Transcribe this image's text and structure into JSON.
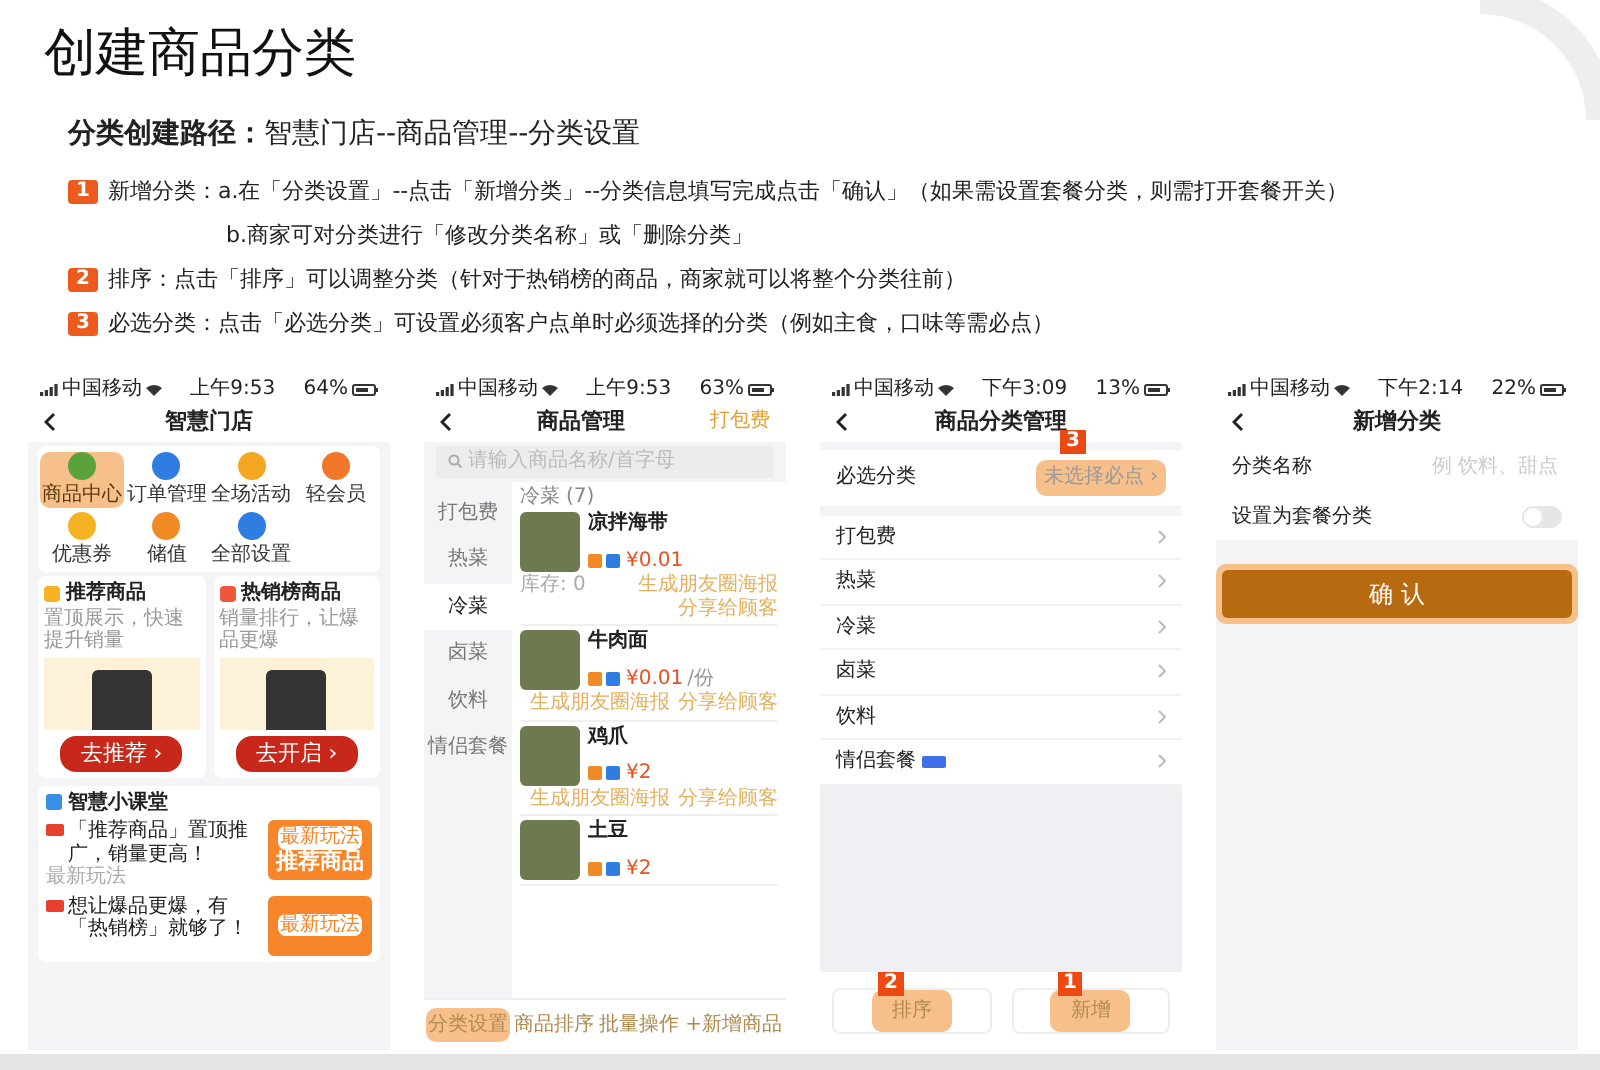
{
  "title": "创建商品分类",
  "path": {
    "label": "分类创建路径：",
    "value": "智慧门店--商品管理--分类设置"
  },
  "steps": [
    {
      "number": "1",
      "lines": [
        "新增分类：a.在「分类设置」--点击「新增分类」--分类信息填写完成点击「确认」（如果需设置套餐分类，则需打开套餐开关）",
        "b.商家可对分类进行「修改分类名称」或「删除分类」"
      ]
    },
    {
      "number": "2",
      "lines": [
        "排序：点击「排序」可以调整分类（针对于热销榜的商品，商家就可以将整个分类往前）"
      ]
    },
    {
      "number": "3",
      "lines": [
        "必选分类：点击「必选分类」可设置必须客户点单时必须选择的分类（例如主食，口味等需必点）"
      ]
    }
  ],
  "screens": [
    {
      "kind": "store",
      "status": {
        "carrier": "中国移动",
        "time": "上午9:53",
        "battery": "64%"
      },
      "title": "智慧门店",
      "grid": [
        {
          "label": "商品中心",
          "color": "#5aa23c",
          "highlighted": true
        },
        {
          "label": "订单管理",
          "color": "#2f7de1",
          "highlighted": false
        },
        {
          "label": "全场活动",
          "color": "#f5a623",
          "highlighted": false
        },
        {
          "label": "轻会员",
          "color": "#f07828",
          "highlighted": false
        },
        {
          "label": "优惠券",
          "color": "#f5b323",
          "highlighted": false
        },
        {
          "label": "储值",
          "color": "#f08a24",
          "highlighted": false
        },
        {
          "label": "全部设置",
          "color": "#2f7de1",
          "highlighted": false
        }
      ],
      "cards": [
        {
          "title": "推荐商品",
          "subtitle": "置顶展示，快速提升销量",
          "button": "去推荐 ›",
          "color": "#f5b323"
        },
        {
          "title": "热销榜商品",
          "subtitle": "销量排行，让爆品更爆",
          "button": "去开启 ›",
          "color": "#f0563c"
        }
      ],
      "course": {
        "title": "智慧小课堂",
        "items": [
          {
            "text": "「推荐商品」置顶推广，销量更高！",
            "note": "最新玩法",
            "thumb_tag": "最新玩法",
            "thumb_title": "推荐商品"
          },
          {
            "text": "想让爆品更爆，有「热销榜」就够了！",
            "thumb_tag": "最新玩法"
          }
        ]
      }
    },
    {
      "kind": "goods",
      "status": {
        "carrier": "中国移动",
        "time": "上午9:53",
        "battery": "63%"
      },
      "title": "商品管理",
      "action": "打包费",
      "search": {
        "placeholder": "请输入商品名称/首字母"
      },
      "categories": [
        {
          "label": "打包费",
          "selected": false
        },
        {
          "label": "热菜",
          "selected": false
        },
        {
          "label": "冷菜",
          "selected": true
        },
        {
          "label": "卤菜",
          "selected": false
        },
        {
          "label": "饮料",
          "selected": false
        },
        {
          "label": "情侣套餐",
          "selected": false
        }
      ],
      "list_header": {
        "name": "冷菜",
        "count": "(7)"
      },
      "products": [
        {
          "name": "凉拌海带",
          "price": "¥0.01",
          "stock": "库存: 0",
          "links": [
            "生成朋友圈海报",
            "分享给顾客"
          ]
        },
        {
          "name": "牛肉面",
          "price": "¥0.01",
          "unit": "/份",
          "links": [
            "生成朋友圈海报",
            "分享给顾客"
          ]
        },
        {
          "name": "鸡爪",
          "price": "¥2",
          "links": [
            "生成朋友圈海报",
            "分享给顾客"
          ]
        },
        {
          "name": "土豆",
          "price": "¥2"
        }
      ],
      "bottom": [
        {
          "label": "分类设置",
          "highlighted": true
        },
        {
          "label": "商品排序",
          "highlighted": false
        },
        {
          "label": "批量操作",
          "highlighted": false
        },
        {
          "label": "+新增商品",
          "highlighted": false
        }
      ]
    },
    {
      "kind": "categories",
      "status": {
        "carrier": "中国移动",
        "time": "下午3:09",
        "battery": "13%"
      },
      "title": "商品分类管理",
      "required": {
        "label": "必选分类",
        "value": "未选择必点 ›",
        "highlighted": true,
        "callout": "3"
      },
      "rows": [
        {
          "label": "打包费",
          "tagged": false
        },
        {
          "label": "热菜",
          "tagged": false
        },
        {
          "label": "冷菜",
          "tagged": false
        },
        {
          "label": "卤菜",
          "tagged": false
        },
        {
          "label": "饮料",
          "tagged": false
        },
        {
          "label": "情侣套餐",
          "tagged": true
        }
      ],
      "buttons": [
        {
          "label": "排序",
          "highlighted": true,
          "callout": "2"
        },
        {
          "label": "新增",
          "highlighted": true,
          "callout": "1"
        }
      ]
    },
    {
      "kind": "add",
      "status": {
        "carrier": "中国移动",
        "time": "下午2:14",
        "battery": "22%"
      },
      "title": "新增分类",
      "field": {
        "label": "分类名称",
        "placeholder": "例 饮料、甜点"
      },
      "toggle": {
        "label": "设置为套餐分类",
        "on": false
      },
      "confirm": {
        "label": "确 认",
        "highlighted": true
      }
    }
  ]
}
